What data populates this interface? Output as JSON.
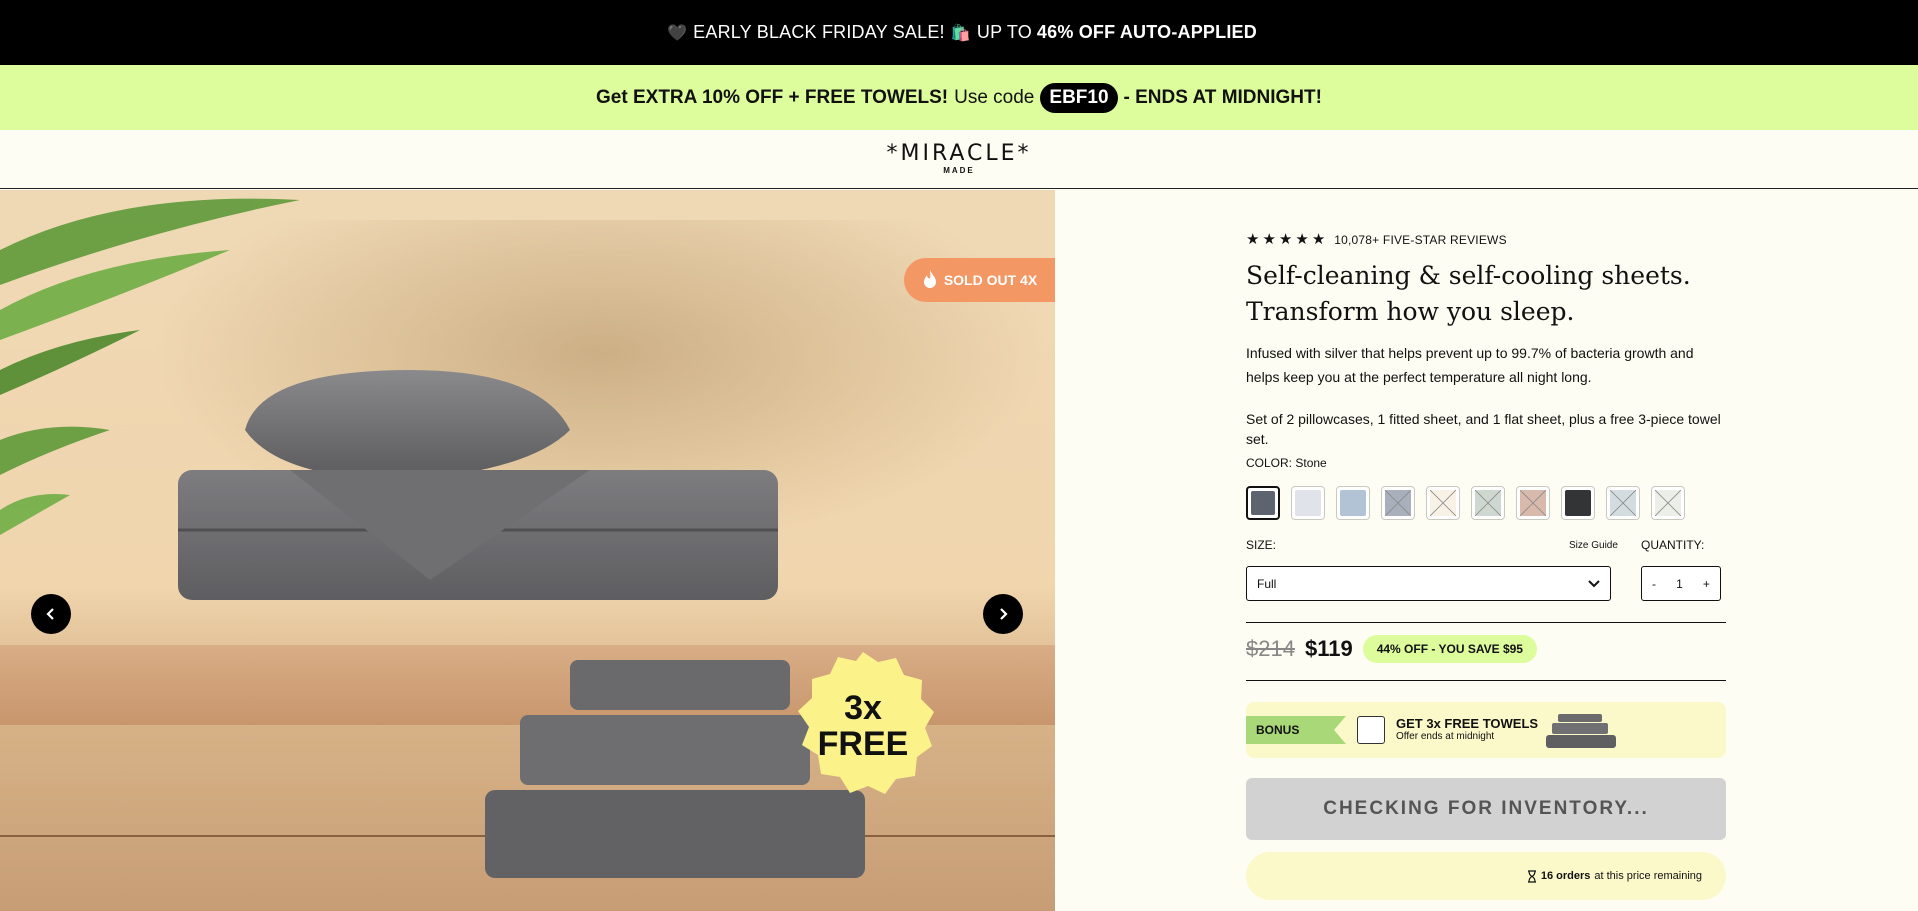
{
  "announcement": {
    "heart": "🖤",
    "lead": "EARLY BLACK FRIDAY SALE!",
    "bags": "🛍️",
    "mid": "UP TO",
    "bold": "46% OFF AUTO-APPLIED"
  },
  "promo": {
    "bold_lead": "Get EXTRA 10% OFF + FREE TOWELS!",
    "plain": "Use code",
    "code": "EBF10",
    "tail": "- ENDS AT MIDNIGHT!"
  },
  "logo": {
    "main": "*MIRACLE*",
    "sub": "MADE"
  },
  "gallery": {
    "sold_out": "SOLD OUT 4X",
    "badge_line1": "3x",
    "badge_line2": "FREE"
  },
  "product": {
    "reviews": "10,078+ FIVE-STAR REVIEWS",
    "rating": 5,
    "title_line1": "Self-cleaning & self-cooling sheets.",
    "title_line2": "Transform how you sleep.",
    "desc1": "Infused with silver that helps prevent up to 99.7% of bacteria growth and helps keep you at the perfect temperature all night long.",
    "desc2": "Set of 2 pillowcases, 1 fitted sheet, and 1 flat sheet, plus a free 3-piece towel set.",
    "color_label": "COLOR:",
    "color_value": "Stone",
    "swatches": [
      {
        "color": "#5e6370",
        "available": true,
        "selected": true
      },
      {
        "color": "#e1e3ea",
        "available": true
      },
      {
        "color": "#b3c3d6",
        "available": true
      },
      {
        "color": "#a9b0bb",
        "available": false
      },
      {
        "color": "#f7f1e6",
        "available": false
      },
      {
        "color": "#cfd8d0",
        "available": false
      },
      {
        "color": "#d8b9ab",
        "available": false
      },
      {
        "color": "#333436",
        "available": true
      },
      {
        "color": "#d3dde0",
        "available": false
      },
      {
        "color": "#eceee8",
        "available": false
      }
    ],
    "size_label": "SIZE:",
    "size_guide": "Size Guide",
    "size_value": "Full",
    "qty_label": "QUANTITY:",
    "qty_minus": "-",
    "qty_value": "1",
    "qty_plus": "+",
    "price_old": "$214",
    "price_new": "$119",
    "save_text": "44% OFF - YOU SAVE $95",
    "bonus_tag": "BONUS",
    "bonus_title": "GET 3x FREE TOWELS",
    "bonus_sub": "Offer ends at midnight",
    "inventory_btn": "CHECKING FOR INVENTORY...",
    "remaining_count": "16 orders",
    "remaining_text": "at this price remaining"
  }
}
